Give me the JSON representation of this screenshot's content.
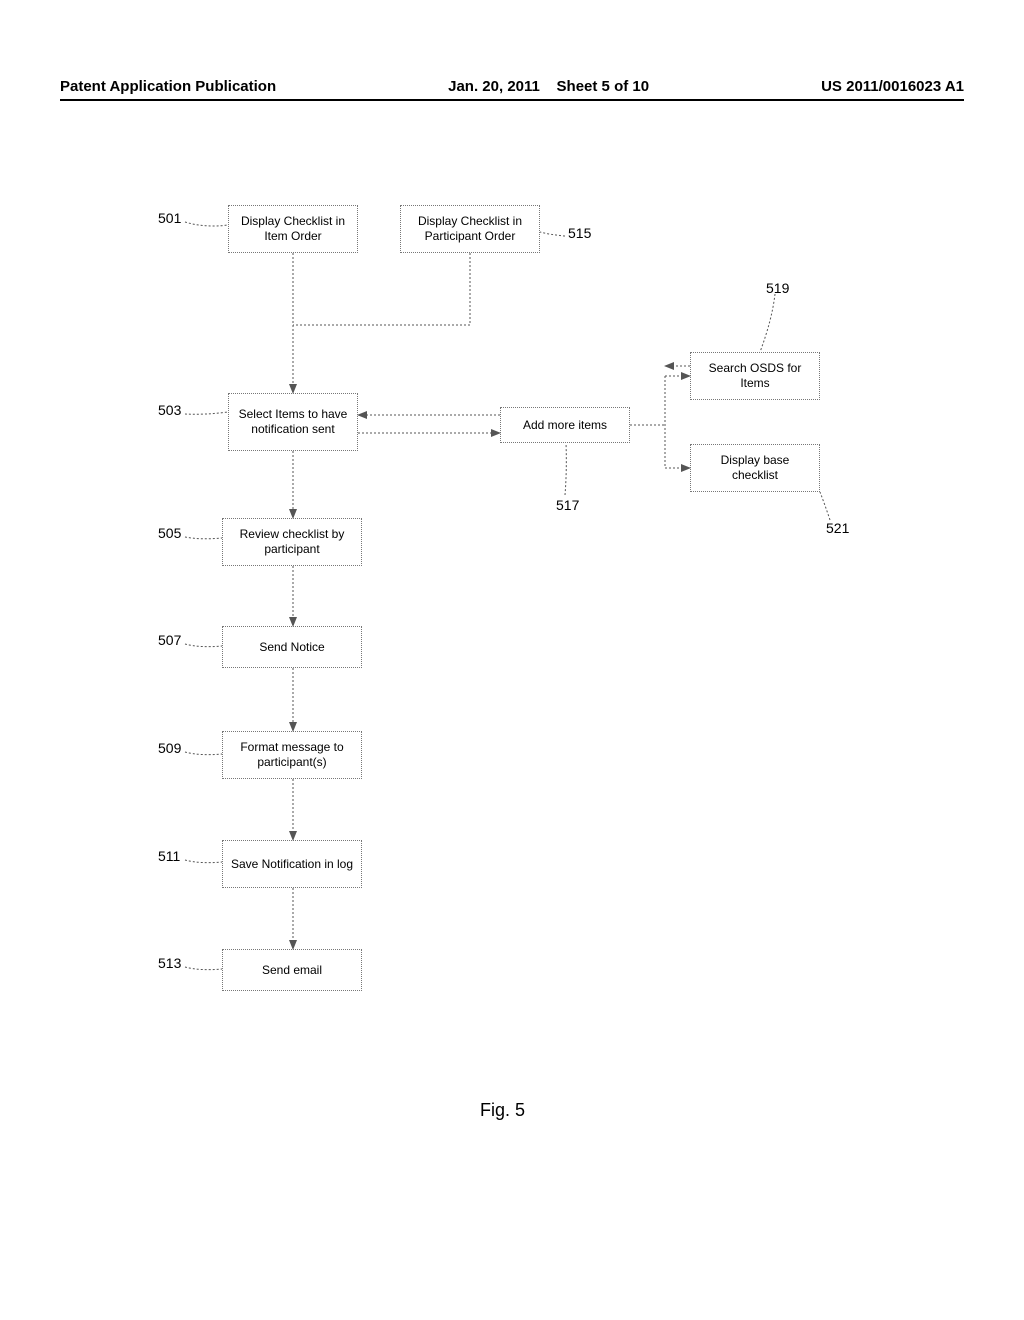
{
  "header": {
    "left": "Patent Application Publication",
    "center_date": "Jan. 20, 2011",
    "center_sheet": "Sheet 5 of 10",
    "right": "US 2011/0016023 A1"
  },
  "boxes": {
    "b501": "Display Checklist in Item Order",
    "b515": "Display Checklist in Participant Order",
    "b503": "Select Items to have notification sent",
    "b517": "Add more items",
    "b519": "Search OSDS for Items",
    "b521": "Display base checklist",
    "b505": "Review checklist by participant",
    "b507": "Send Notice",
    "b509": "Format message to participant(s)",
    "b511": "Save Notification in log",
    "b513": "Send email"
  },
  "labels": {
    "l501": "501",
    "l503": "503",
    "l505": "505",
    "l507": "507",
    "l509": "509",
    "l511": "511",
    "l513": "513",
    "l515": "515",
    "l517": "517",
    "l519": "519",
    "l521": "521"
  },
  "figure_caption": "Fig. 5"
}
